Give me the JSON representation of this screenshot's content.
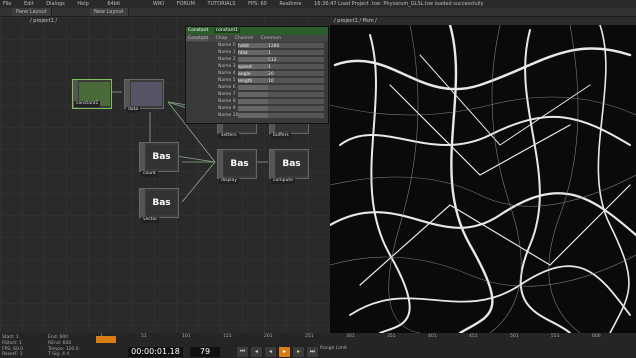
{
  "menu": [
    "File",
    "Edit",
    "Dialogs",
    "Help"
  ],
  "toolbar": {
    "build": "64bit",
    "wiki": "WIKI",
    "forum": "FORUM",
    "tutorials": "TUTORIALS",
    "fps": "FPS: 60",
    "realtime": "Realtime",
    "status": "16:36:47 Load Project .toe: Physarum_GLSL.toe loaded successfully"
  },
  "tabs": [
    "Pane Layout",
    "New Layout"
  ],
  "network": {
    "path": "/ project1 /",
    "nodes": [
      {
        "name": "constant1",
        "label": ""
      },
      {
        "name": "data",
        "label": ""
      },
      {
        "name": "setters",
        "label": "Bas"
      },
      {
        "name": "buffers",
        "label": "Bas"
      },
      {
        "name": "count",
        "label": "Bas"
      },
      {
        "name": "display",
        "label": "Bas"
      },
      {
        "name": "compute",
        "label": "Bas"
      },
      {
        "name": "vector",
        "label": "Bas"
      }
    ]
  },
  "params": {
    "type": "Constant",
    "name": "constant1",
    "tabs": [
      "Constant",
      "Chop",
      "Channel",
      "Common"
    ],
    "rows": [
      {
        "label": "Name 0",
        "name": "hdist",
        "value": "1280"
      },
      {
        "label": "Name 1",
        "name": "fdist",
        "value": "1"
      },
      {
        "name": "",
        "label": "Name 2",
        "value": "512"
      },
      {
        "label": "Name 3",
        "name": "speed",
        "value": "1"
      },
      {
        "label": "Name 4",
        "name": "angle",
        "value": "20"
      },
      {
        "label": "Name 5",
        "name": "length",
        "value": "10"
      },
      {
        "label": "Name 6",
        "name": "",
        "value": ""
      },
      {
        "label": "Name 7",
        "name": "",
        "value": ""
      },
      {
        "label": "Name 8",
        "name": "",
        "value": ""
      },
      {
        "label": "Name 9",
        "name": "",
        "value": ""
      },
      {
        "label": "Name 10",
        "name": "",
        "value": ""
      }
    ]
  },
  "viewer": {
    "path": "/ project1 / ffsm /"
  },
  "timeline": {
    "start_label": "Start:",
    "start": "1",
    "end_label": "End:",
    "end": "600",
    "rstart_label": "RStart:",
    "rstart": "1",
    "rend_label": "REnd:",
    "rend": "600",
    "fps_label": "FPS:",
    "fps": "60.0",
    "tempo_label": "Tempo:",
    "tempo": "120.0",
    "resetf_label": "ResetF:",
    "resetf": "1",
    "tsig_label": "T Sig:",
    "tsig1": "4",
    "tsig2": "4",
    "timecode": "00:00:01.18",
    "frame": "79",
    "range_label": "Range Limit",
    "ticks": [
      "1",
      "51",
      "101",
      "151",
      "201",
      "251",
      "301",
      "351",
      "401",
      "451",
      "501",
      "551",
      "600"
    ]
  },
  "colors": {
    "accent": "#d77d14",
    "node_selected": "#7fbf55",
    "panel_header": "#2d5d2d"
  }
}
